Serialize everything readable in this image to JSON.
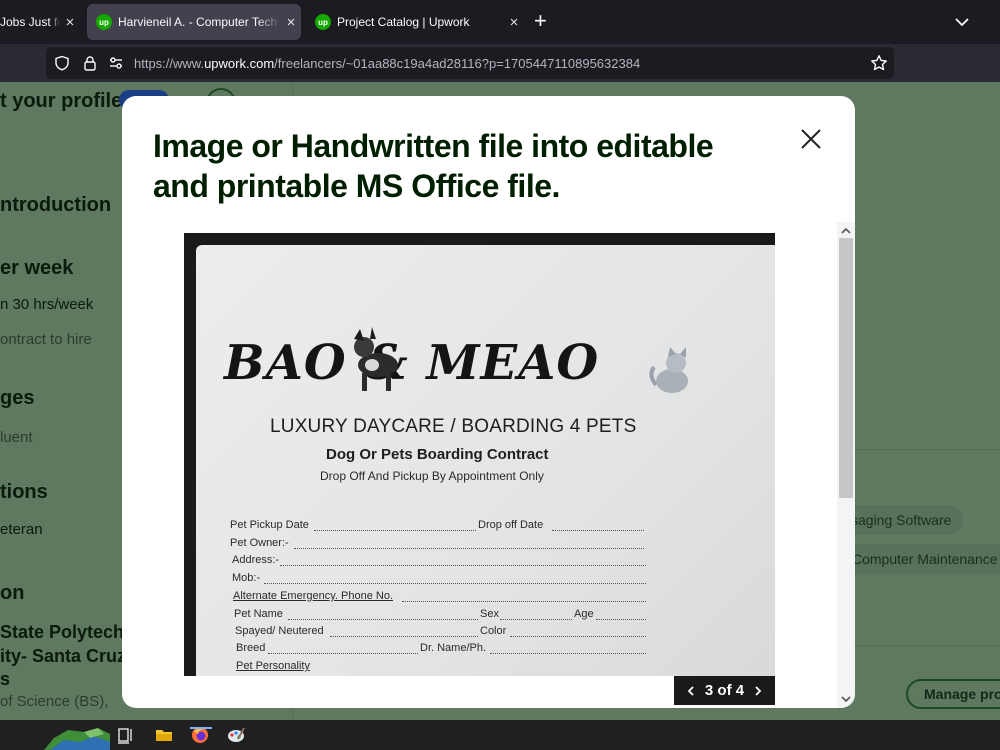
{
  "browser": {
    "tabs": [
      {
        "title": "Jobs Just fo",
        "active": false
      },
      {
        "title": "Harvieneil A. - Computer Tech",
        "active": true
      },
      {
        "title": "Project Catalog | Upwork",
        "active": false
      }
    ],
    "tab_favicon_text": "up",
    "url": {
      "prefix": "https://www.",
      "domain": "upwork.com",
      "path": "/freelancers/~01aa88c19a4ad28116?p=1705447110895632384"
    }
  },
  "profile_bg": {
    "edit_profile": "t your profile",
    "introduction": "ntroduction",
    "hours_heading": "er week",
    "hours_value": "n 30 hrs/week",
    "contract": "ontract to hire",
    "languages": "ges",
    "fluent": "luent",
    "verifications": "tions",
    "veteran": "eteran",
    "education": "on",
    "school_line1": "State Polytech",
    "school_line2": "ity- Santa Cruz",
    "school_line3": "s",
    "degree": "of Science (BS),",
    "skill_1": "ssaging Software",
    "skill_2": "Computer Maintenance",
    "manage_button": "Manage proj"
  },
  "modal": {
    "title": "Image or Handwritten file into editable and printable MS Office file.",
    "pager": {
      "current": 3,
      "total": 4,
      "text": "3 of 4"
    }
  },
  "document_image": {
    "brand": "BAO & MEAO",
    "heading": "LUXURY DAYCARE / BOARDING 4 PETS",
    "subheading": "Dog Or Pets Boarding Contract",
    "note": "Drop Off And Pickup By Appointment Only",
    "fields": {
      "pickup": "Pet Pickup Date",
      "dropoff": "Drop off Date",
      "owner": "Pet Owner:-",
      "address": "Address:-",
      "mob": "Mob:-",
      "alt_phone": "Alternate Emergency. Phone No.",
      "pet_name": "Pet Name",
      "sex": "Sex",
      "age": "Age",
      "spayed": "Spayed/ Neutered",
      "color": "Color",
      "breed": "Breed",
      "dr": "Dr. Name/Ph.",
      "personality": "Pet Personality"
    }
  },
  "colors": {
    "upwork_green": "#14a800",
    "modal_title": "#001e00",
    "page_overlay": "#5f7860",
    "browser_bg": "#1c1b22"
  }
}
